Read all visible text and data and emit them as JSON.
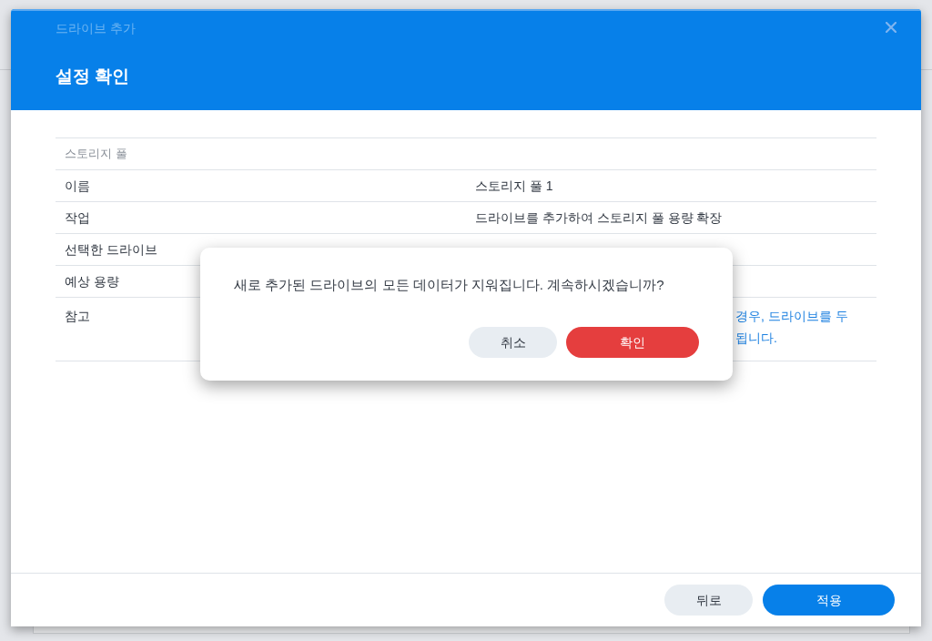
{
  "window": {
    "subtitle": "드라이브 추가",
    "title": "설정 확인"
  },
  "summary": {
    "section": "스토리지 풀",
    "rows": [
      {
        "label": "이름",
        "value": "스토리지 풀 1",
        "kind": "plain"
      },
      {
        "label": "작업",
        "value": "드라이브를 추가하여 스토리지 풀 용량 확장",
        "kind": "plain"
      },
      {
        "label": "선택한 드라이브",
        "kind": "plain"
      },
      {
        "label": "예상 용량",
        "kind": "plain"
      },
      {
        "label": "참고",
        "kind": "note",
        "lines": [
          "경우, 드라이브를 두",
          "됩니다."
        ]
      }
    ]
  },
  "footer": {
    "buttons": [
      {
        "label": "뒤로",
        "kind": "secondary"
      },
      {
        "label": "적용",
        "kind": "primary"
      }
    ]
  },
  "dialog": {
    "message": "새로 추가된 드라이브의 모든 데이터가 지워집니다. 계속하시겠습니까?",
    "buttons": [
      {
        "label": "취소",
        "kind": "secondary"
      },
      {
        "label": "확인",
        "kind": "danger"
      }
    ]
  }
}
